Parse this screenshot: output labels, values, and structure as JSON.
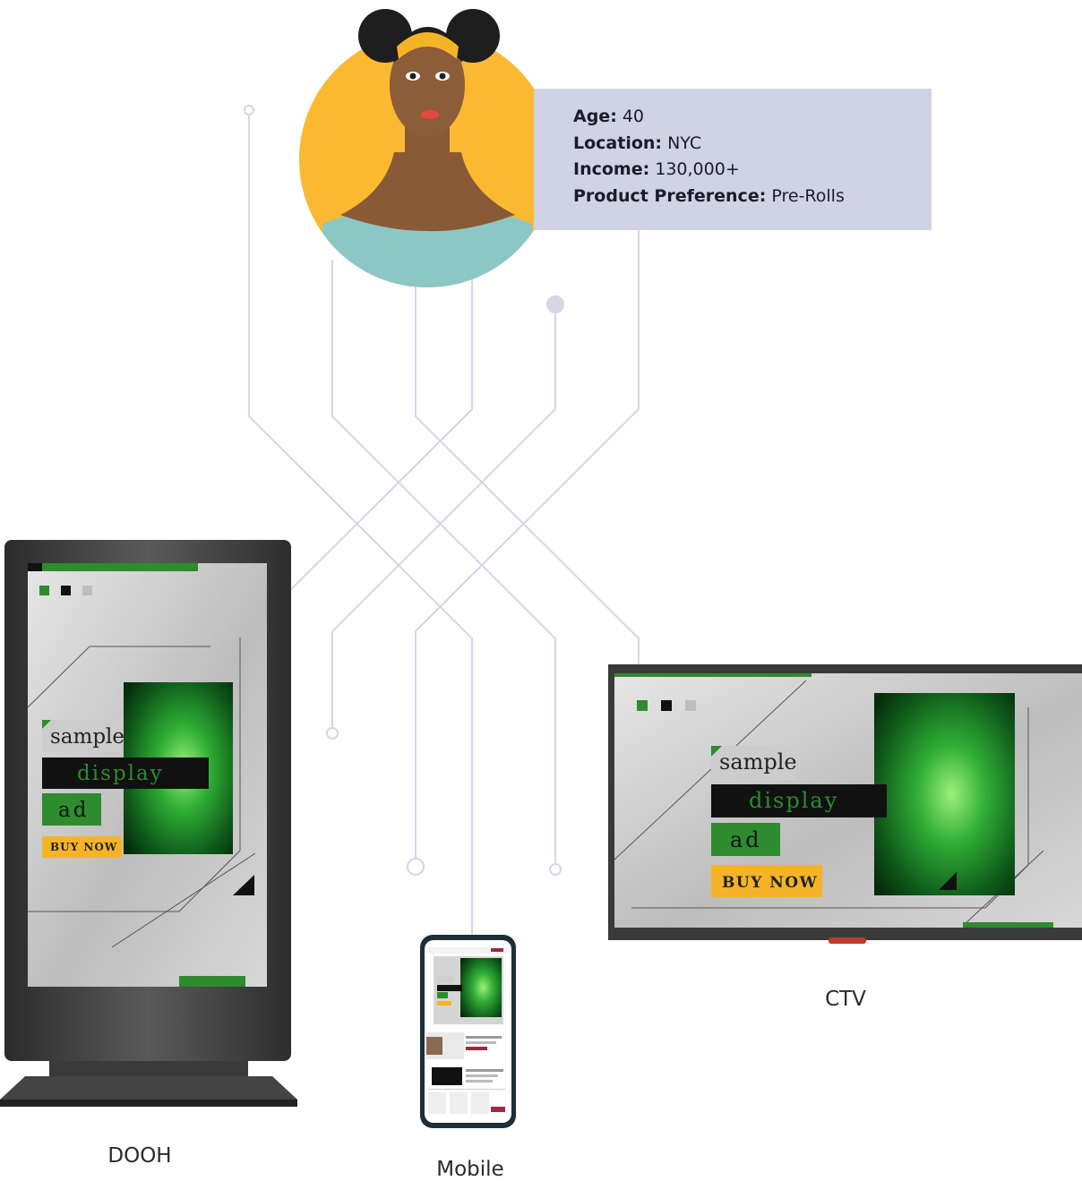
{
  "persona": {
    "age_label": "Age:",
    "age_value": "40",
    "location_label": "Location:",
    "location_value": "NYC",
    "income_label": "Income:",
    "income_value": "130,000+",
    "preference_label": "Product Preference:",
    "preference_value": "Pre-Rolls"
  },
  "ad": {
    "line1": "sample",
    "line2": "display",
    "line3": "ad",
    "cta": "BUY NOW"
  },
  "devices": {
    "dooh": "DOOH",
    "mobile": "Mobile",
    "ctv": "CTV"
  },
  "colors": {
    "avatar_bg": "#fbb931",
    "card_bg": "#cfd3e3",
    "connector": "#d3d7e6",
    "accent_green": "#2e8b2e",
    "cta_yellow": "#f5b428"
  }
}
